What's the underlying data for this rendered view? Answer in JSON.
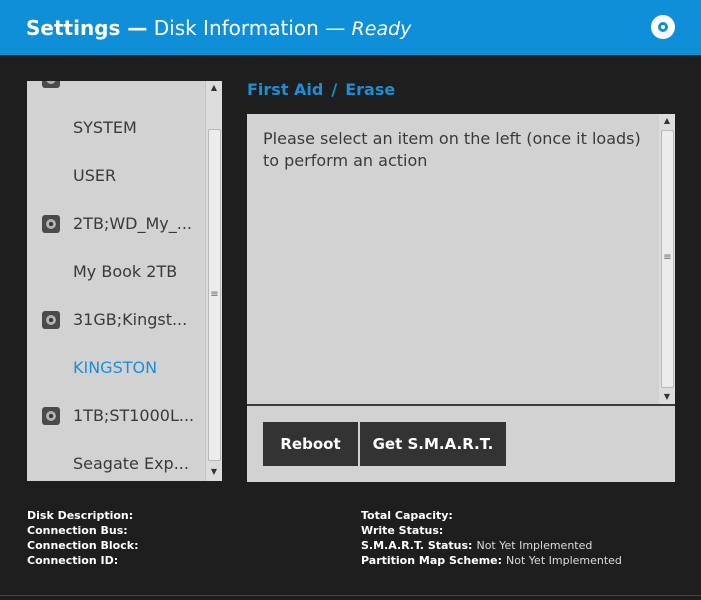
{
  "header": {
    "app": "Settings —",
    "section": "Disk Information",
    "dash": "—",
    "status": "Ready"
  },
  "sidebar": {
    "items": [
      {
        "label": "",
        "icon": "disk-icon",
        "type": "partial"
      },
      {
        "label": "SYSTEM",
        "icon": null
      },
      {
        "label": "USER",
        "icon": null
      },
      {
        "label": "2TB;WD_My_...",
        "icon": "disk-icon"
      },
      {
        "label": "My Book 2TB",
        "icon": null
      },
      {
        "label": "31GB;Kingst...",
        "icon": "disk-icon"
      },
      {
        "label": "KINGSTON",
        "icon": null,
        "active": true
      },
      {
        "label": "1TB;ST1000L...",
        "icon": "disk-icon"
      },
      {
        "label": "Seagate Exp...",
        "icon": null
      }
    ]
  },
  "tabs": {
    "first_aid": "First Aid",
    "separator": "/",
    "erase": "Erase"
  },
  "main": {
    "message": "Please select an item on the left (once it loads) to perform an action"
  },
  "buttons": {
    "reboot": "Reboot",
    "get_smart": "Get S.M.A.R.T."
  },
  "info": {
    "left": [
      {
        "key": "Disk Description:",
        "value": ""
      },
      {
        "key": "Connection Bus:",
        "value": ""
      },
      {
        "key": "Connection Block:",
        "value": ""
      },
      {
        "key": "Connection ID:",
        "value": ""
      }
    ],
    "right": [
      {
        "key": "Total Capacity:",
        "value": ""
      },
      {
        "key": "Write Status:",
        "value": ""
      },
      {
        "key": "S.M.A.R.T. Status:",
        "value": "Not Yet Implemented"
      },
      {
        "key": "Partition Map Scheme:",
        "value": "Not Yet Implemented"
      }
    ]
  },
  "colors": {
    "accent": "#0e8fd8",
    "link": "#1b8fd6",
    "background": "#1e1e1e",
    "panel": "#d2d2d2",
    "button": "#333333"
  }
}
